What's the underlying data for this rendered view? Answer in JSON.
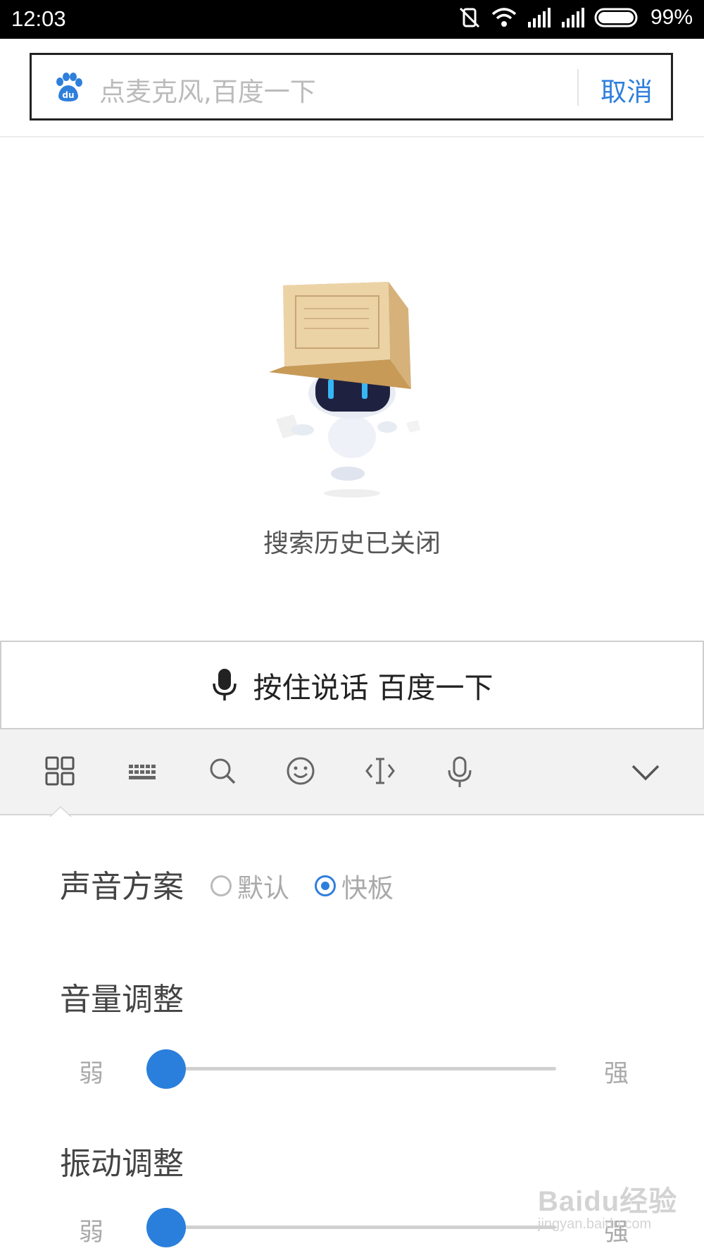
{
  "status_bar": {
    "time": "12:03",
    "battery_pct": "99%"
  },
  "search": {
    "placeholder": "点麦克风,百度一下",
    "cancel_label": "取消"
  },
  "history": {
    "message": "搜索历史已关闭"
  },
  "voice": {
    "talk_label": "按住说话 百度一下"
  },
  "toolbar": {
    "icons": [
      "grid-icon",
      "keyboard-icon",
      "search-icon",
      "emoji-icon",
      "cursor-icon",
      "mic-icon",
      "chevron-down-icon"
    ]
  },
  "settings": {
    "sound_scheme": {
      "title": "声音方案",
      "options": [
        "默认",
        "快板"
      ],
      "selected": "快板"
    },
    "volume": {
      "title": "音量调整",
      "min_label": "弱",
      "max_label": "强",
      "level": 0
    },
    "vibration": {
      "title": "振动调整",
      "min_label": "弱",
      "max_label": "强",
      "level": 0
    }
  },
  "watermark": {
    "brand": "Baidu经验",
    "url": "jingyan.baidu.com"
  },
  "colors": {
    "accent": "#2e7fdc",
    "status_bar": "#000000",
    "toolbar_bg": "#f2f2f2"
  }
}
